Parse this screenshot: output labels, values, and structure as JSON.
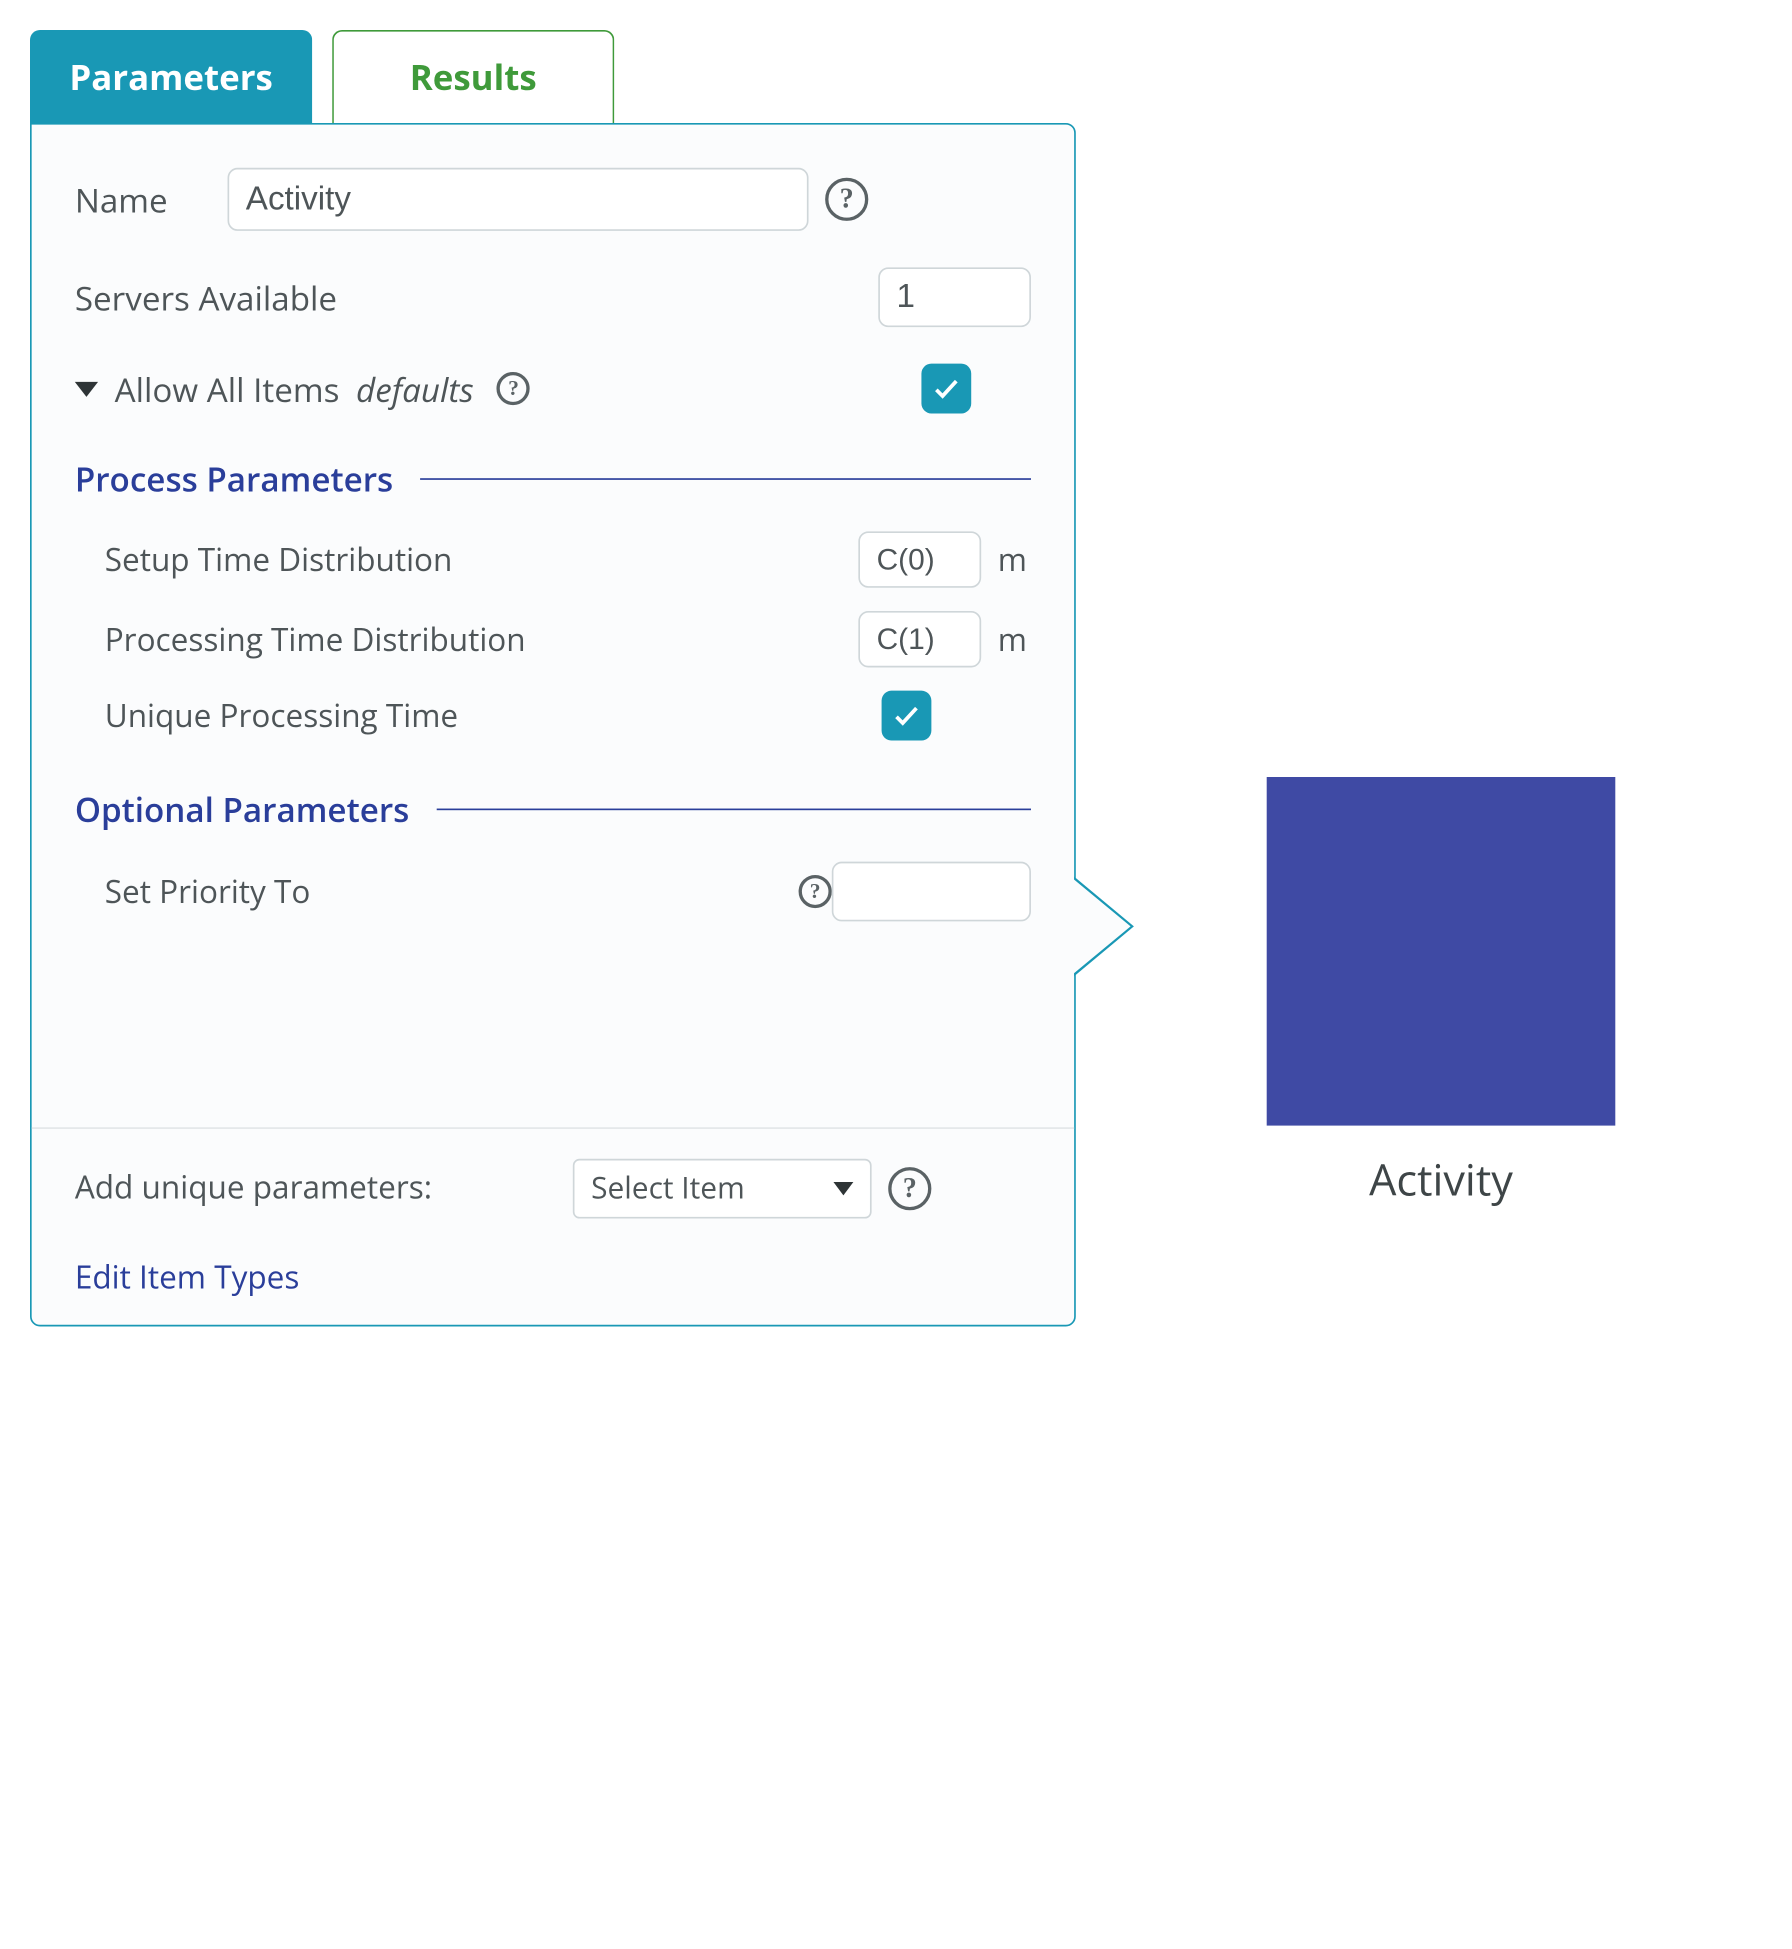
{
  "tabs": {
    "parameters": "Parameters",
    "results": "Results"
  },
  "fields": {
    "name_label": "Name",
    "name_value": "Activity",
    "servers_label": "Servers Available",
    "servers_value": "1",
    "allow_all_label": "Allow All Items",
    "allow_all_defaults": "defaults",
    "allow_all_checked": true
  },
  "sections": {
    "process": {
      "title": "Process Parameters",
      "setup_label": "Setup Time Distribution",
      "setup_value": "C(0)",
      "setup_unit": "m",
      "processing_label": "Processing Time Distribution",
      "processing_value": "C(1)",
      "processing_unit": "m",
      "unique_label": "Unique Processing Time",
      "unique_checked": true
    },
    "optional": {
      "title": "Optional Parameters",
      "priority_label": "Set Priority To",
      "priority_value": ""
    }
  },
  "footer": {
    "add_unique_label": "Add unique parameters:",
    "select_placeholder": "Select Item",
    "edit_link": "Edit Item Types"
  },
  "node": {
    "label": "Activity",
    "color": "#3f4aa4"
  },
  "help_glyph": "?"
}
